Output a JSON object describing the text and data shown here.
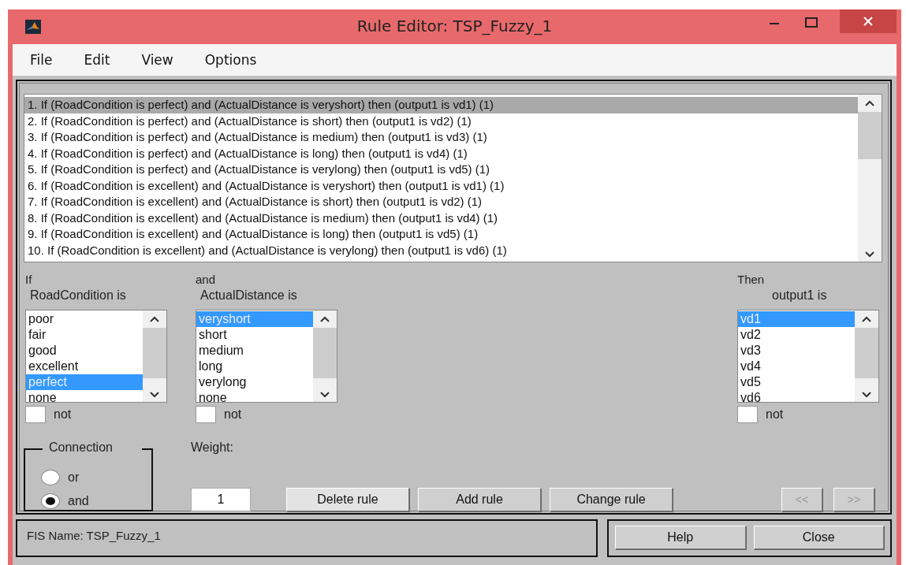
{
  "window": {
    "title": "Rule Editor: TSP_Fuzzy_1"
  },
  "menu": [
    "File",
    "Edit",
    "View",
    "Options"
  ],
  "rules": [
    {
      "text": "1. If (RoadCondition is perfect) and (ActualDistance is veryshort) then (output1 is vd1) (1)",
      "selected": true
    },
    {
      "text": "2. If (RoadCondition is perfect) and (ActualDistance is short) then (output1 is vd2) (1)",
      "selected": false
    },
    {
      "text": "3. If (RoadCondition is perfect) and (ActualDistance is medium) then (output1 is vd3) (1)",
      "selected": false
    },
    {
      "text": "4. If (RoadCondition is perfect) and (ActualDistance is long) then (output1 is vd4) (1)",
      "selected": false
    },
    {
      "text": "5. If (RoadCondition is perfect) and (ActualDistance is verylong) then (output1 is vd5) (1)",
      "selected": false
    },
    {
      "text": "6. If (RoadCondition is excellent) and (ActualDistance is veryshort) then (output1 is vd1) (1)",
      "selected": false
    },
    {
      "text": "7. If (RoadCondition is excellent) and (ActualDistance is short) then (output1 is vd2) (1)",
      "selected": false
    },
    {
      "text": "8. If (RoadCondition is excellent) and (ActualDistance is medium) then (output1 is vd4) (1)",
      "selected": false
    },
    {
      "text": "9. If (RoadCondition is excellent) and (ActualDistance is long) then (output1 is vd5) (1)",
      "selected": false
    },
    {
      "text": "10. If (RoadCondition is excellent) and (ActualDistance is verylong) then (output1 is vd6) (1)",
      "selected": false
    }
  ],
  "variables": [
    {
      "heading": "If",
      "label": "RoadCondition is",
      "not_checked": false,
      "not_label": "not",
      "items": [
        {
          "text": "poor",
          "selected": false
        },
        {
          "text": "fair",
          "selected": false
        },
        {
          "text": "good",
          "selected": false
        },
        {
          "text": "excellent",
          "selected": false
        },
        {
          "text": "perfect",
          "selected": true
        },
        {
          "text": "none",
          "selected": false
        }
      ]
    },
    {
      "heading": "and",
      "label": "ActualDistance is",
      "not_checked": false,
      "not_label": "not",
      "items": [
        {
          "text": "veryshort",
          "selected": true
        },
        {
          "text": "short",
          "selected": false
        },
        {
          "text": "medium",
          "selected": false
        },
        {
          "text": "long",
          "selected": false
        },
        {
          "text": "verylong",
          "selected": false
        },
        {
          "text": "none",
          "selected": false
        }
      ]
    },
    {
      "heading": "Then",
      "label": "output1 is",
      "not_checked": false,
      "not_label": "not",
      "items": [
        {
          "text": "vd1",
          "selected": true
        },
        {
          "text": "vd2",
          "selected": false
        },
        {
          "text": "vd3",
          "selected": false
        },
        {
          "text": "vd4",
          "selected": false
        },
        {
          "text": "vd5",
          "selected": false
        },
        {
          "text": "vd6",
          "selected": false
        }
      ]
    }
  ],
  "connection": {
    "title": "Connection",
    "options": [
      {
        "label": "or",
        "selected": false
      },
      {
        "label": "and",
        "selected": true
      }
    ]
  },
  "weight": {
    "label": "Weight:",
    "value": "1"
  },
  "rule_buttons": [
    "Delete rule",
    "Add rule",
    "Change rule"
  ],
  "nav_buttons": [
    {
      "label": "<<",
      "disabled": true
    },
    {
      "label": ">>",
      "disabled": true
    }
  ],
  "status": "FIS Name: TSP_Fuzzy_1",
  "footer_buttons": [
    "Help",
    "Close"
  ]
}
